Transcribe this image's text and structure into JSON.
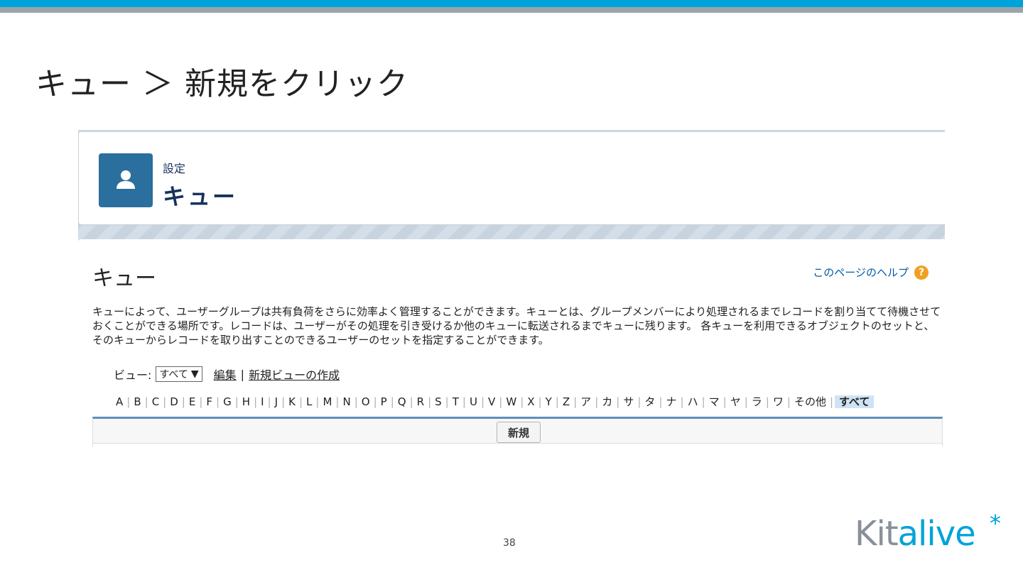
{
  "slide": {
    "title": "キュー ＞ 新規をクリック",
    "page_number": "38",
    "logo": {
      "part1": "Kit",
      "part2": "alive",
      "mark": "*"
    }
  },
  "header": {
    "breadcrumb": "設定",
    "title": "キュー",
    "icon": "user-icon"
  },
  "content": {
    "heading": "キュー",
    "help_link": "このページのヘルプ",
    "description": "キューによって、ユーザーグループは共有負荷をさらに効率よく管理することができます。キューとは、グループメンバーにより処理されるまでレコードを割り当てて待機させておくことができる場所です。レコードは、ユーザーがその処理を引き受けるか他のキューに転送されるまでキューに残ります。 各キューを利用できるオブジェクトのセットと、そのキューからレコードを取り出すことのできるユーザーのセットを指定することができます。",
    "view_label": "ビュー:",
    "view_selected": "すべて",
    "edit_link": "編集",
    "new_view_link": "新規ビューの作成",
    "alphabet": [
      "A",
      "B",
      "C",
      "D",
      "E",
      "F",
      "G",
      "H",
      "I",
      "J",
      "K",
      "L",
      "M",
      "N",
      "O",
      "P",
      "Q",
      "R",
      "S",
      "T",
      "U",
      "V",
      "W",
      "X",
      "Y",
      "Z",
      "ア",
      "カ",
      "サ",
      "タ",
      "ナ",
      "ハ",
      "マ",
      "ヤ",
      "ラ",
      "ワ",
      "その他"
    ],
    "alphabet_selected": "すべて",
    "new_button": "新規"
  },
  "colors": {
    "brand_cyan": "#00a3d9",
    "icon_blue": "#2a6f9e",
    "header_text": "#16325c"
  }
}
